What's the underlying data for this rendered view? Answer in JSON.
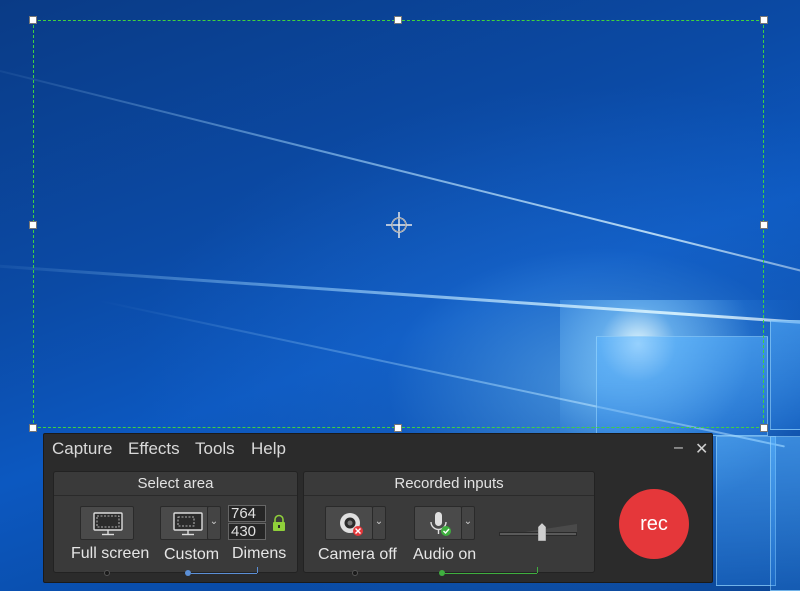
{
  "selection": {
    "width": "764",
    "height": "430"
  },
  "menu": {
    "capture": "Capture",
    "effects": "Effects",
    "tools": "Tools",
    "help": "Help"
  },
  "window_controls": {
    "minimize": "–",
    "close": "✕"
  },
  "select_area": {
    "title": "Select area",
    "full_screen_label": "Full screen",
    "custom_label": "Custom",
    "dimensions_label": "Dimens",
    "dropdown_glyph": "⌄"
  },
  "recorded_inputs": {
    "title": "Recorded inputs",
    "camera_label": "Camera off",
    "audio_label": "Audio on",
    "dropdown_glyph": "⌄",
    "audio_volume_fraction": 0.55
  },
  "rec_label": "rec",
  "colors": {
    "selection_border": "#3fd23f",
    "rec_button": "#e5373a",
    "accent_blue": "#5b8fd6",
    "accent_green": "#3fae3f",
    "toolbar_bg": "#2b2b2b",
    "panel_bg": "#3a3a3a"
  },
  "icons": {
    "crosshair": "crosshair-icon",
    "full_screen": "monitor-icon",
    "custom": "custom-region-icon",
    "lock": "lock-icon",
    "camera": "webcam-off-icon",
    "audio": "microphone-on-icon"
  }
}
